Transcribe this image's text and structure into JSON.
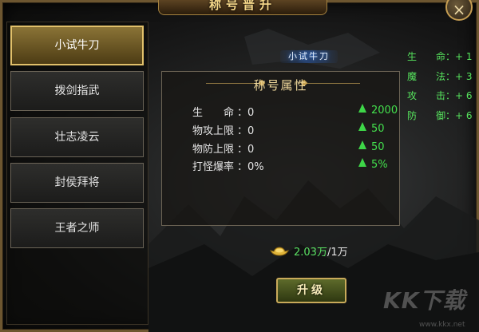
{
  "window": {
    "title": "称号晋升",
    "close_label": "×"
  },
  "sidebar": {
    "items": [
      {
        "label": "小试牛刀",
        "active": true
      },
      {
        "label": "拨剑指武",
        "active": false
      },
      {
        "label": "壮志凌云",
        "active": false
      },
      {
        "label": "封侯拜将",
        "active": false
      },
      {
        "label": "王者之师",
        "active": false
      }
    ]
  },
  "stage": {
    "name": "小试牛刀"
  },
  "side_stats": [
    {
      "label": "生　　命：+ 1"
    },
    {
      "label": "魔　　法：+ 3"
    },
    {
      "label": "攻　　击：+ 6"
    },
    {
      "label": "防　　御：+ 6"
    }
  ],
  "attributes": {
    "title": "称号属性",
    "rows": [
      {
        "label": "生　　命",
        "value": "：0",
        "bonus": "2000"
      },
      {
        "label": "物攻上限",
        "value": "：0",
        "bonus": "50"
      },
      {
        "label": "物防上限",
        "value": "：0",
        "bonus": "50"
      },
      {
        "label": "打怪爆率",
        "value": "：0%",
        "bonus": "5%"
      }
    ]
  },
  "cost": {
    "have": "2.03万",
    "need": "/1万"
  },
  "upgrade": {
    "label": "升级"
  },
  "watermark": {
    "text": "KK下载",
    "url": "www.kkx.net"
  },
  "colors": {
    "accent_gold": "#e1c06a",
    "stat_green": "#43e04d",
    "panel_border": "#6b6354"
  }
}
